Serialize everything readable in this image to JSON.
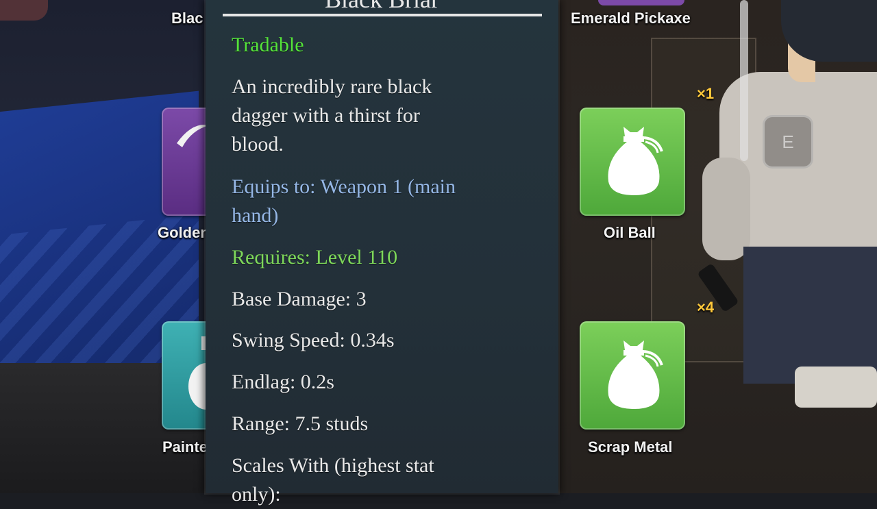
{
  "inventory": {
    "left_items": [
      {
        "label": "Blac"
      },
      {
        "label": "Golden"
      },
      {
        "label": "Painte"
      }
    ],
    "right_items": [
      {
        "label": "Emerald Pickaxe"
      },
      {
        "label": "Oil Ball",
        "count": "×1"
      },
      {
        "label": "Scrap Metal",
        "count": "×4"
      }
    ]
  },
  "hud": {
    "interact_key": "E"
  },
  "tooltip": {
    "title": "Black Briar",
    "tradable": "Tradable",
    "description_lines": [
      "An incredibly rare black",
      "dagger with a thirst for",
      "blood."
    ],
    "equips_lines": [
      "Equips to: Weapon 1 (main",
      "hand)"
    ],
    "requires": "Requires: Level 110",
    "base_damage": "Base Damage: 3",
    "swing_speed": "Swing Speed: 0.34s",
    "endlag": "Endlag: 0.2s",
    "range": "Range: 7.5 studs",
    "scales_lines": [
      "Scales With (highest stat",
      "only):"
    ]
  },
  "colors": {
    "tradable": "#55e43a",
    "requires": "#7ed85a",
    "equips": "#95b7e6",
    "count": "#ffc83a",
    "slot_green": "#5fbf45",
    "slot_purple": "#6b3a96",
    "slot_teal": "#2f9ca0"
  },
  "icons": {
    "oil_ball": "sack-icon",
    "scrap_metal": "sack-icon"
  }
}
